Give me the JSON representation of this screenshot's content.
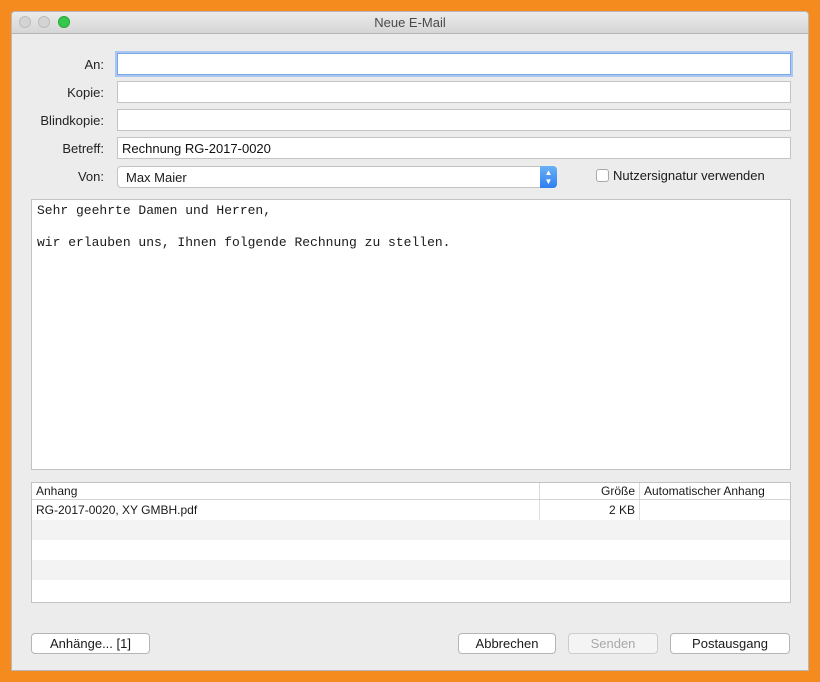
{
  "window": {
    "title": "Neue E-Mail"
  },
  "form": {
    "to_label": "An:",
    "to_value": "",
    "cc_label": "Kopie:",
    "cc_value": "",
    "bcc_label": "Blindkopie:",
    "bcc_value": "",
    "subject_label": "Betreff:",
    "subject_value": "Rechnung RG-2017-0020",
    "from_label": "Von:",
    "from_value": "Max Maier",
    "signature_label": "Nutzersignatur verwenden"
  },
  "message": {
    "body": "Sehr geehrte Damen und Herren,\n\nwir erlauben uns, Ihnen folgende Rechnung zu stellen."
  },
  "attachments": {
    "columns": [
      "Anhang",
      "Größe",
      "Automatischer Anhang"
    ],
    "rows": [
      {
        "name": "RG-2017-0020, XY GMBH.pdf",
        "size": "2 KB",
        "auto": ""
      }
    ]
  },
  "buttons": {
    "attachments": "Anhänge... [1]",
    "cancel": "Abbrechen",
    "send": "Senden",
    "outbox": "Postausgang"
  }
}
